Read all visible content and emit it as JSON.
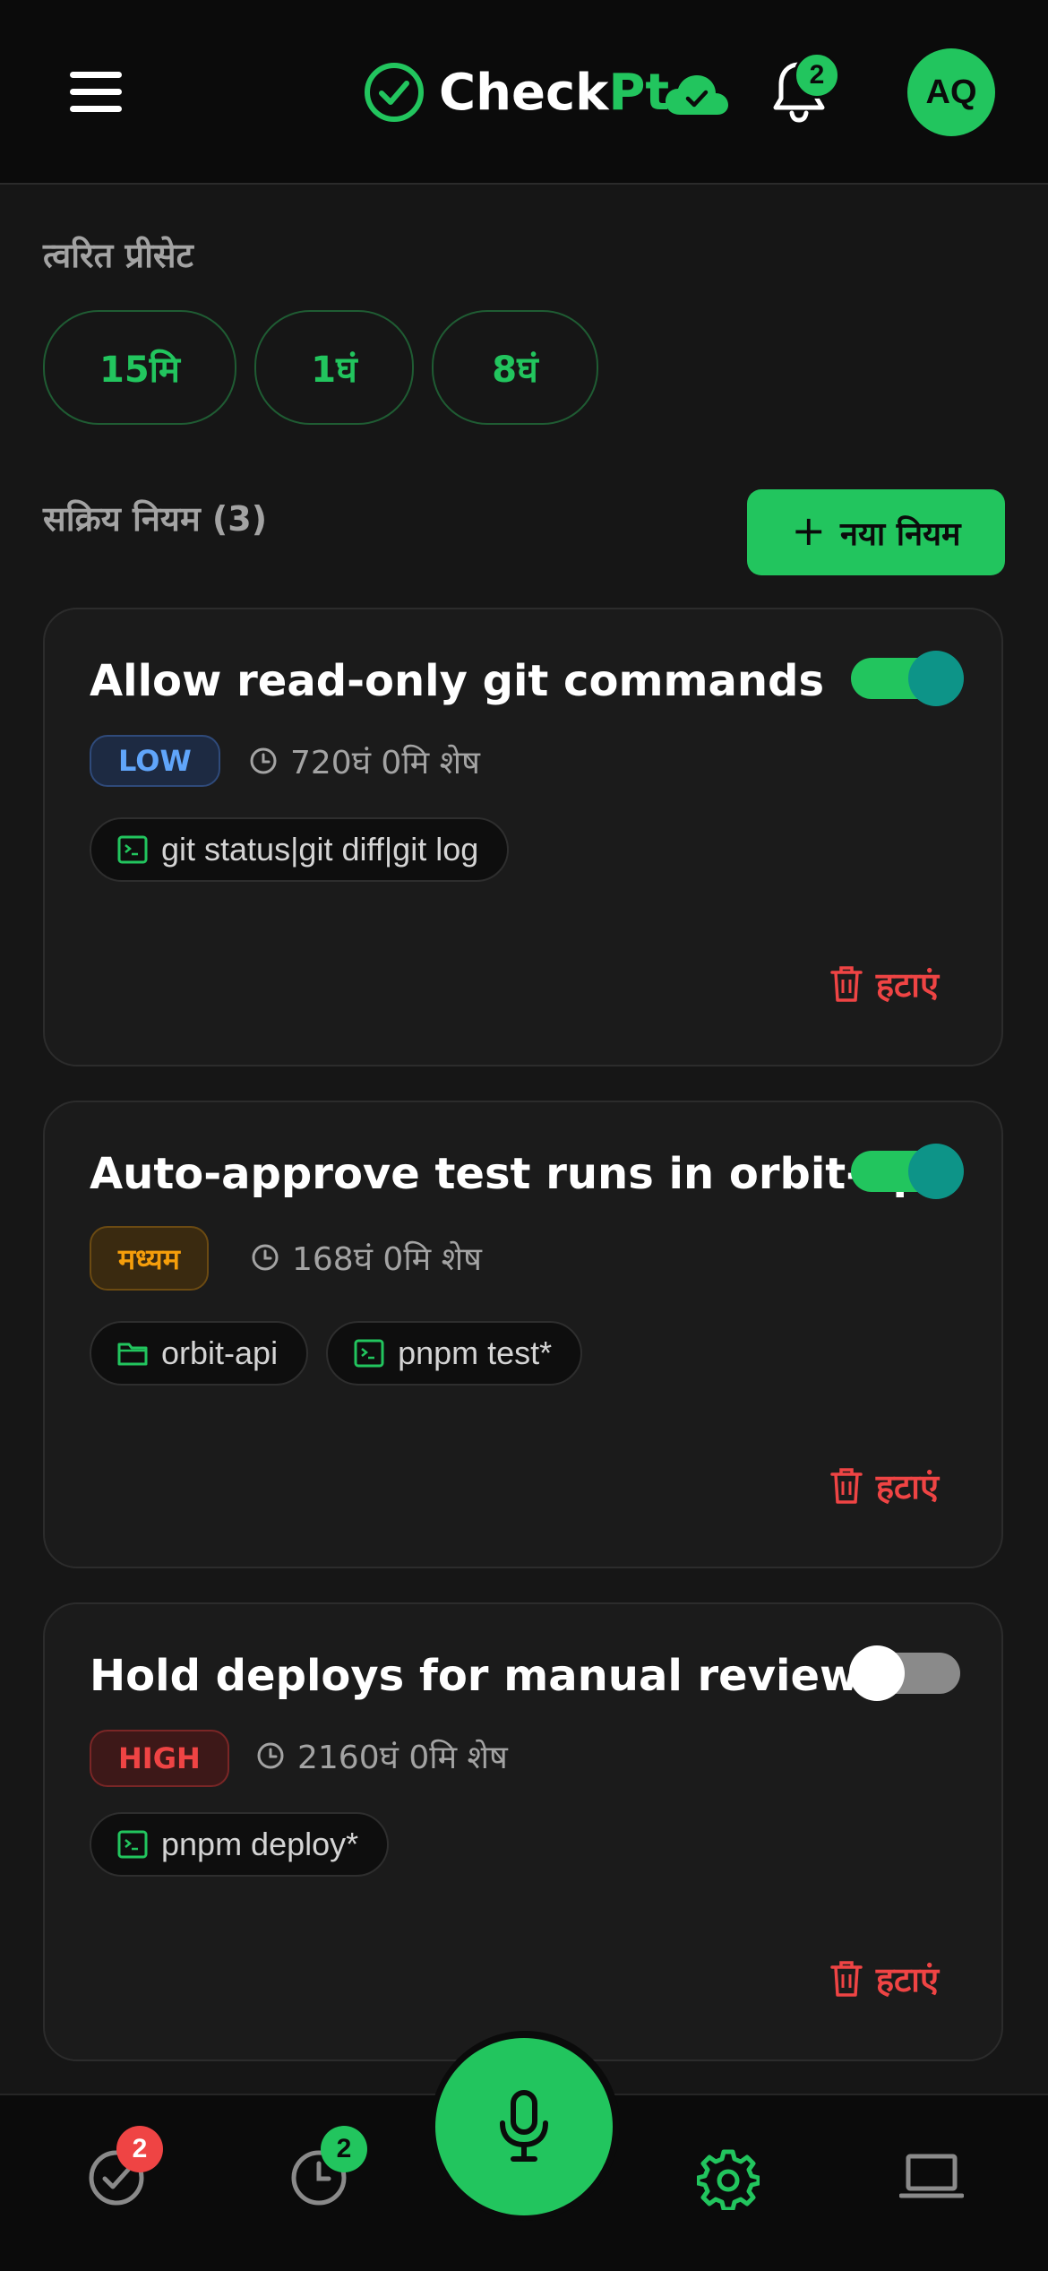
{
  "header": {
    "brand_main": "Check",
    "brand_accent": "Pt",
    "notification_count": "2",
    "avatar_initials": "AQ"
  },
  "presets": {
    "title": "त्वरित प्रीसेट",
    "items": [
      "15मि",
      "1घं",
      "8घं"
    ]
  },
  "rules_section": {
    "title": "सक्रिय नियम (3)",
    "new_rule_label": "नया नियम"
  },
  "rules": [
    {
      "title": "Allow read-only git commands",
      "enabled": true,
      "risk": "LOW",
      "remaining": "720घं 0मि शेष",
      "chips": [
        {
          "icon": "terminal-icon",
          "text": "git status|git diff|git log"
        }
      ],
      "delete_label": "हटाएं"
    },
    {
      "title": "Auto-approve test runs in orbit-api",
      "enabled": true,
      "risk": "मध्यम",
      "remaining": "168घं 0मि शेष",
      "chips": [
        {
          "icon": "folder-icon",
          "text": "orbit-api"
        },
        {
          "icon": "terminal-icon",
          "text": "pnpm test*"
        }
      ],
      "delete_label": "हटाएं"
    },
    {
      "title": "Hold deploys for manual review",
      "enabled": false,
      "risk": "HIGH",
      "remaining": "2160घं 0मि शेष",
      "chips": [
        {
          "icon": "terminal-icon",
          "text": "pnpm deploy*"
        }
      ],
      "delete_label": "हटाएं"
    }
  ],
  "bottom_nav": {
    "approvals_badge": "2",
    "history_badge": "2"
  },
  "colors": {
    "accent": "#22c55e",
    "danger": "#ef4444",
    "warning": "#f59e0b",
    "info": "#60a5fa",
    "background": "#161616"
  }
}
